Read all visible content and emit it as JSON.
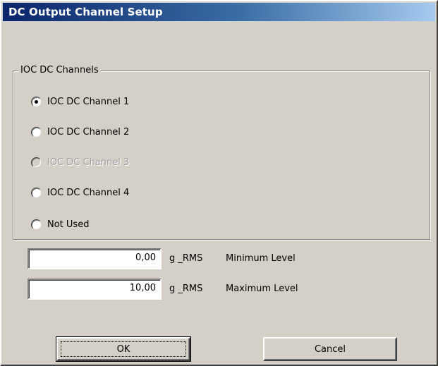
{
  "window": {
    "title": "DC Output Channel Setup"
  },
  "group": {
    "title": "IOC DC Channels",
    "options": [
      {
        "label": "IOC DC Channel 1",
        "checked": true,
        "enabled": true
      },
      {
        "label": "IOC DC Channel 2",
        "checked": false,
        "enabled": true
      },
      {
        "label": "IOC DC Channel 3",
        "checked": false,
        "enabled": false
      },
      {
        "label": "IOC DC Channel 4",
        "checked": false,
        "enabled": true
      },
      {
        "label": "Not Used",
        "checked": false,
        "enabled": true
      }
    ]
  },
  "levels": {
    "min": {
      "value": "0,00",
      "unit": "g _RMS",
      "label": "Minimum Level"
    },
    "max": {
      "value": "10,00",
      "unit": "g _RMS",
      "label": "Maximum Level"
    }
  },
  "buttons": {
    "ok": "OK",
    "cancel": "Cancel"
  },
  "colors": {
    "face": "#d4d0c8",
    "title_start": "#0a246a",
    "title_end": "#a6caf0",
    "disabled_text": "#a0a0a0"
  }
}
